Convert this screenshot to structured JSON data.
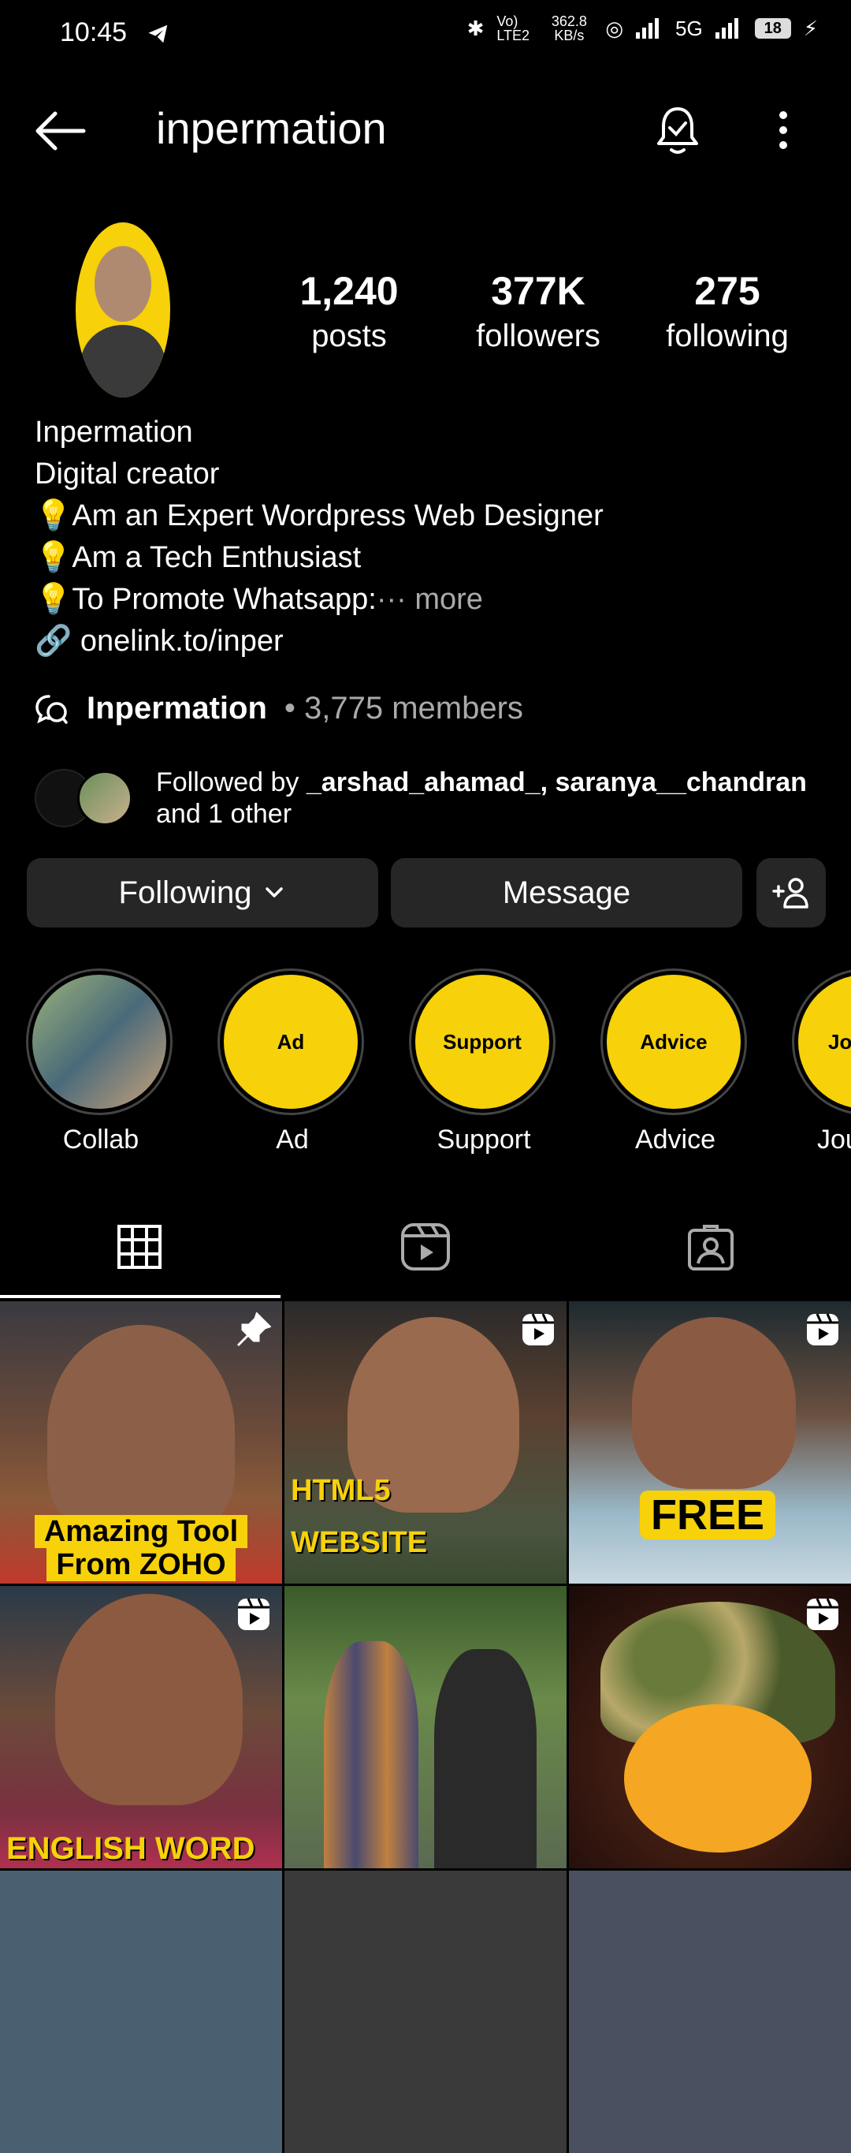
{
  "status": {
    "time": "10:45",
    "speed": "362.8 KB/s",
    "volte": "Vo) LTE2",
    "network": "5G",
    "battery": "18"
  },
  "header": {
    "username": "inpermation"
  },
  "stats": [
    {
      "value": "1,240",
      "label": "posts"
    },
    {
      "value": "377K",
      "label": "followers"
    },
    {
      "value": "275",
      "label": "following"
    }
  ],
  "bio": {
    "name": "Inpermation",
    "category": "Digital creator",
    "lines": [
      "💡Am an Expert Wordpress Web Designer",
      "💡Am a Tech Enthusiast",
      "💡To Promote Whatsapp:"
    ],
    "more": "··· more",
    "link": "onelink.to/inper"
  },
  "channel": {
    "name": "Inpermation",
    "members": "• 3,775 members"
  },
  "followed_by": {
    "prefix": "Followed by ",
    "users": "_arshad_ahamad_, saranya__chandran",
    "suffix": "and 1 other"
  },
  "buttons": {
    "following": "Following",
    "message": "Message"
  },
  "highlights": [
    {
      "label": "Collab",
      "inner": ""
    },
    {
      "label": "Ad",
      "inner": "Ad"
    },
    {
      "label": "Support",
      "inner": "Support"
    },
    {
      "label": "Advice",
      "inner": "Advice"
    },
    {
      "label": "Jou",
      "inner": "Jo"
    }
  ],
  "grid": [
    {
      "caption1": "Amazing Tool",
      "caption2": "From ZOHO",
      "badge": "pin"
    },
    {
      "caption1": "HTML5",
      "caption2": "WEBSITE",
      "badge": "reel"
    },
    {
      "caption1": "FREE",
      "caption2": "",
      "badge": "reel"
    },
    {
      "caption1": "ENGLISH WORD",
      "caption2": "",
      "badge": "reel"
    },
    {
      "caption1": "",
      "caption2": "",
      "badge": ""
    },
    {
      "caption1": "",
      "caption2": "",
      "badge": "reel"
    }
  ],
  "colors": {
    "accent_yellow": "#f7d10a",
    "button_bg": "#262626",
    "muted": "#aaaaaa"
  }
}
